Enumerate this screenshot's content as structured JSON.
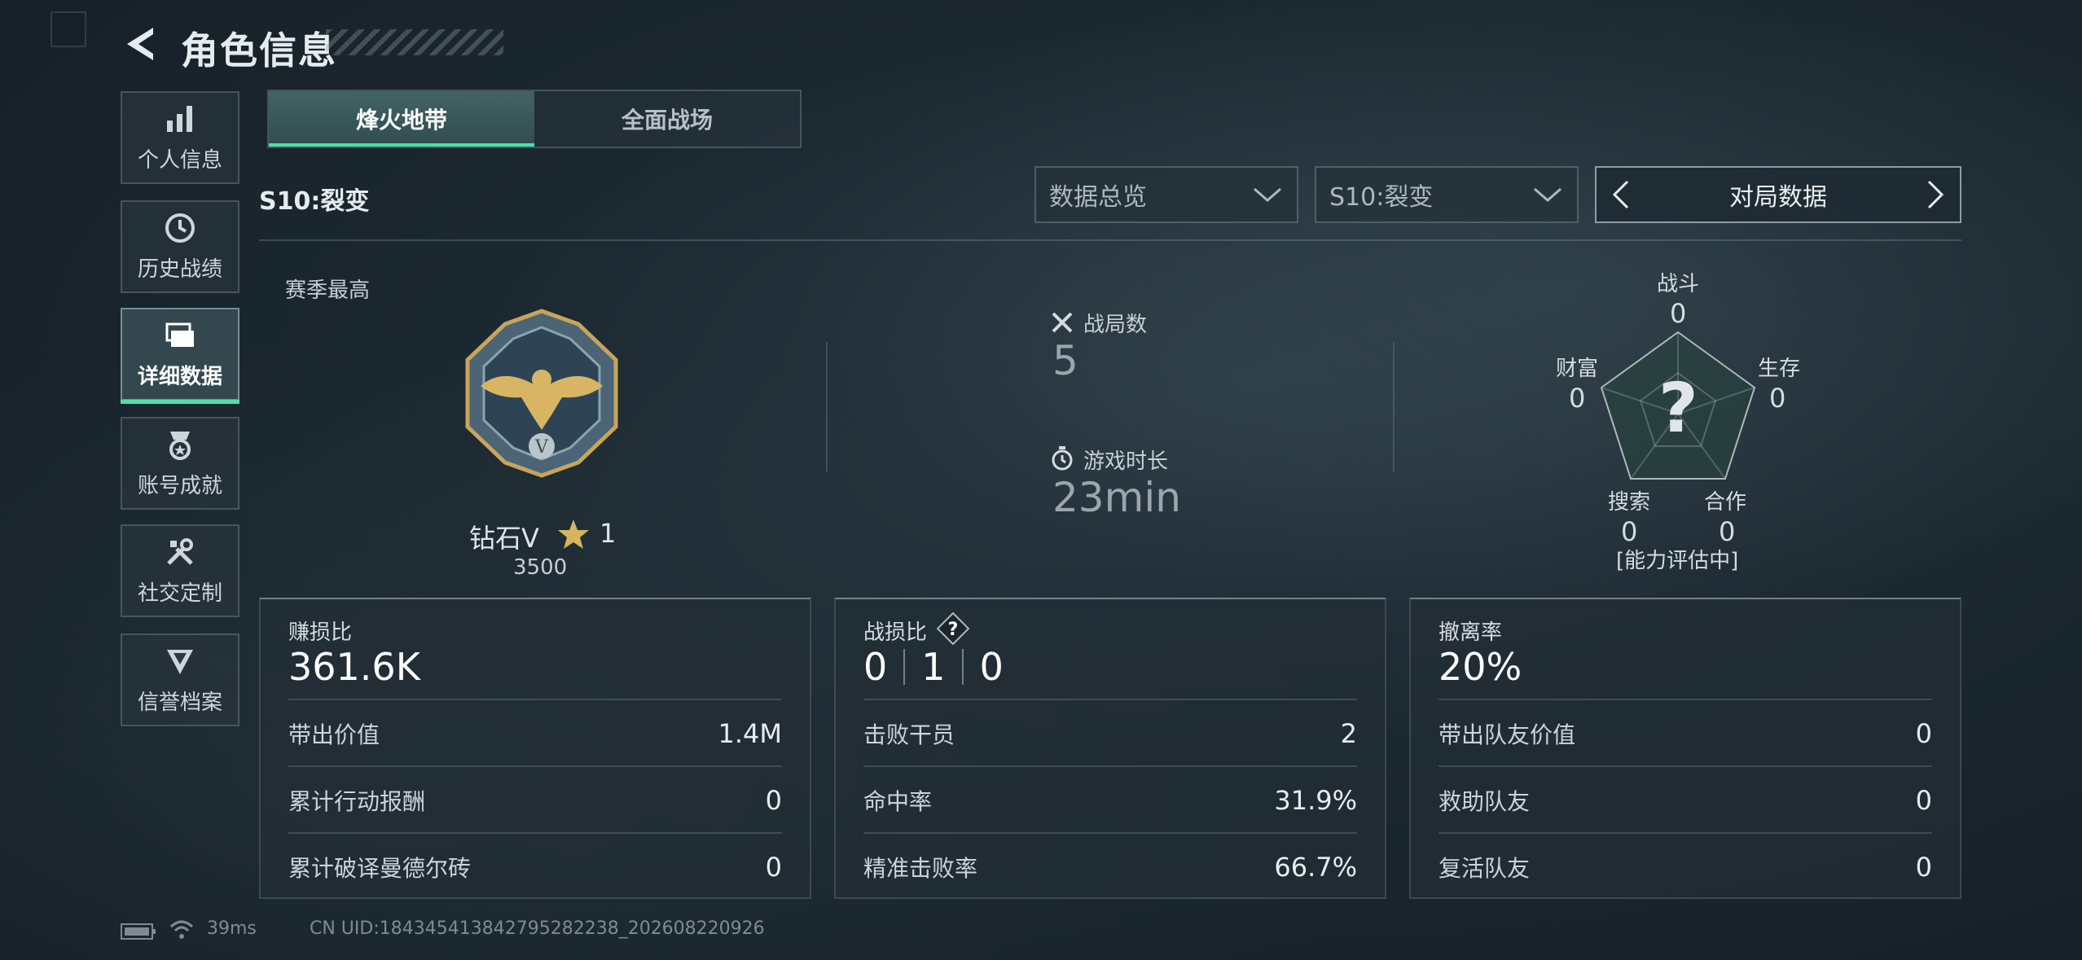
{
  "header": {
    "title": "角色信息"
  },
  "sidebar": {
    "items": [
      {
        "label": "个人信息",
        "icon": "bar-chart-icon"
      },
      {
        "label": "历史战绩",
        "icon": "clock-icon"
      },
      {
        "label": "详细数据",
        "icon": "folders-icon",
        "active": true
      },
      {
        "label": "账号成就",
        "icon": "medal-icon"
      },
      {
        "label": "社交定制",
        "icon": "tools-icon"
      },
      {
        "label": "信誉档案",
        "icon": "shield-chevron-icon"
      }
    ]
  },
  "mode_tabs": [
    {
      "label": "烽火地带",
      "active": true
    },
    {
      "label": "全面战场",
      "active": false
    }
  ],
  "season": {
    "label": "S10:裂变"
  },
  "filters": {
    "data_type": "数据总览",
    "season": "S10:裂变",
    "switcher": "对局数据"
  },
  "season_best": {
    "label": "赛季最高",
    "rank_name": "钻石V",
    "stars": "1",
    "score": "3500"
  },
  "stats": {
    "matches_label": "战局数",
    "matches_value": "5",
    "time_label": "游戏时长",
    "time_value": "23min"
  },
  "radar": {
    "labels": {
      "combat": "战斗",
      "survival": "生存",
      "cooperation": "合作",
      "search": "搜索",
      "wealth": "财富"
    },
    "values": {
      "combat": "0",
      "survival": "0",
      "cooperation": "0",
      "search": "0",
      "wealth": "0"
    },
    "center_mark": "?",
    "status": "[能力评估中]"
  },
  "cards": {
    "profit": {
      "title": "赚损比",
      "big": "361.6K",
      "rows": [
        {
          "label": "带出价值",
          "value": "1.4M"
        },
        {
          "label": "累计行动报酬",
          "value": "0"
        },
        {
          "label": "累计破译曼德尔砖",
          "value": "0"
        }
      ]
    },
    "combat": {
      "title": "战损比",
      "badge": "?",
      "kd": [
        "0",
        "1",
        "0"
      ],
      "rows": [
        {
          "label": "击败干员",
          "value": "2"
        },
        {
          "label": "命中率",
          "value": "31.9%"
        },
        {
          "label": "精准击败率",
          "value": "66.7%"
        }
      ]
    },
    "extract": {
      "title": "撤离率",
      "big": "20%",
      "rows": [
        {
          "label": "带出队友价值",
          "value": "0"
        },
        {
          "label": "救助队友",
          "value": "0"
        },
        {
          "label": "复活队友",
          "value": "0"
        }
      ]
    }
  },
  "footer": {
    "ping": "39ms",
    "uid": "CN UID:18434541384279528223​8_202608220926"
  },
  "colors": {
    "accent": "#4fe0a8",
    "background": "#1c2830"
  }
}
